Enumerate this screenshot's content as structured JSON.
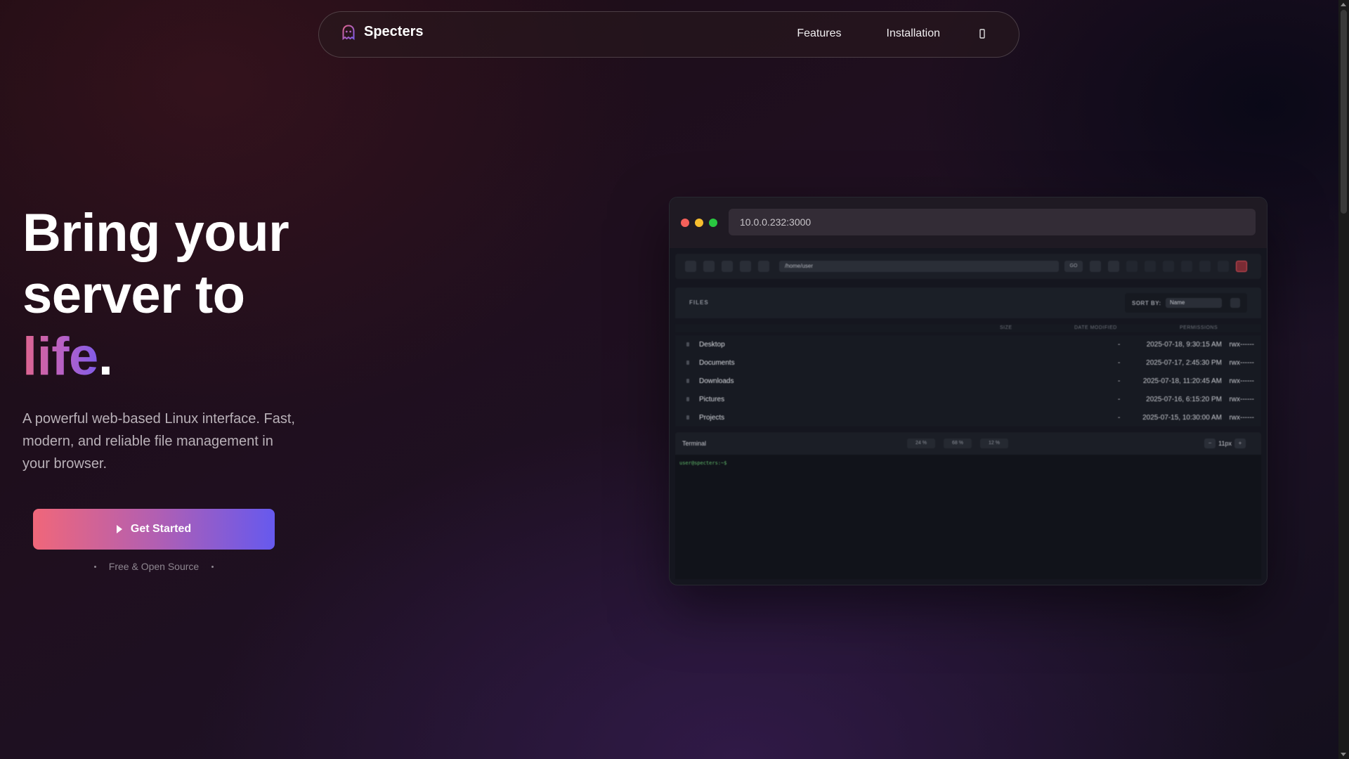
{
  "brand": {
    "name": "Specters",
    "logo_icon": "ghost-icon"
  },
  "nav": {
    "links": [
      "Features",
      "Installation"
    ],
    "extra_icon": "github-icon"
  },
  "hero": {
    "title_line1": "Bring your",
    "title_line2": "server to",
    "title_word3": "life",
    "title_period": ".",
    "description": "A powerful web-based Linux interface. Fast, modern, and reliable file management in your browser.",
    "cta_label": "Get Started",
    "cta_icon": "play-icon",
    "tagline": "Free & Open Source"
  },
  "mockup": {
    "url": "10.0.0.232:3000",
    "path": "/home/user",
    "files_label": "FILES",
    "sort_label": "SORT BY:",
    "sort_value": "Name",
    "columns": [
      "SIZE",
      "DATE MODIFIED",
      "PERMISSIONS"
    ],
    "rows": [
      {
        "name": "Desktop",
        "size": "-",
        "date": "2025-07-18, 9:30:15 AM",
        "perm": "rwx------"
      },
      {
        "name": "Documents",
        "size": "-",
        "date": "2025-07-17, 2:45:30 PM",
        "perm": "rwx------"
      },
      {
        "name": "Downloads",
        "size": "-",
        "date": "2025-07-18, 11:20:45 AM",
        "perm": "rwx------"
      },
      {
        "name": "Pictures",
        "size": "-",
        "date": "2025-07-16, 6:15:20 PM",
        "perm": "rwx------"
      },
      {
        "name": "Projects",
        "size": "-",
        "date": "2025-07-15, 10:30:00 AM",
        "perm": "rwx------"
      }
    ],
    "terminal_label": "Terminal",
    "stats": [
      "24 %",
      "68 %",
      "12 %"
    ],
    "font_size": "11px",
    "prompt": "user@specters:~$"
  },
  "colors": {
    "accent_start": "#f0677a",
    "accent_end": "#6659ee",
    "traffic_red": "#f4605a",
    "traffic_yellow": "#f6be2f",
    "traffic_green": "#29c840"
  }
}
